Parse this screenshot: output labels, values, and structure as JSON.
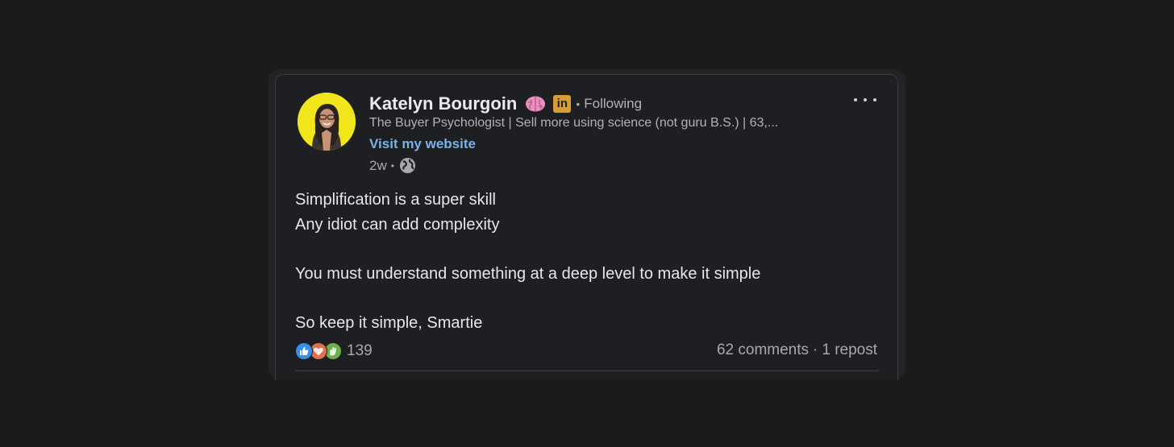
{
  "author": {
    "name": "Katelyn Bourgoin",
    "brain_icon": "brain-icon",
    "badge_icon": "linkedin-icon",
    "badge_text": "in",
    "following": "Following",
    "headline": "The Buyer Psychologist | Sell more using science (not guru B.S.) | 63,...",
    "website_link": "Visit my website",
    "time_ago": "2w",
    "visibility_icon": "globe-icon"
  },
  "post": {
    "lines": [
      "Simplification is a super skill",
      "Any idiot can add complexity",
      "",
      "You must understand something at a deep level to make it simple",
      "",
      "So keep it simple, Smartie"
    ]
  },
  "social": {
    "reaction_icons": [
      "like-icon",
      "love-icon",
      "celebrate-icon"
    ],
    "reaction_count": "139",
    "comments": "62 comments",
    "reposts": "1 repost"
  },
  "colors": {
    "background": "#1b1b1b",
    "card": "#1d1f22",
    "link": "#79b1ea",
    "linkedin_badge": "#d4a036",
    "avatar_bg": "#f1e61c"
  }
}
